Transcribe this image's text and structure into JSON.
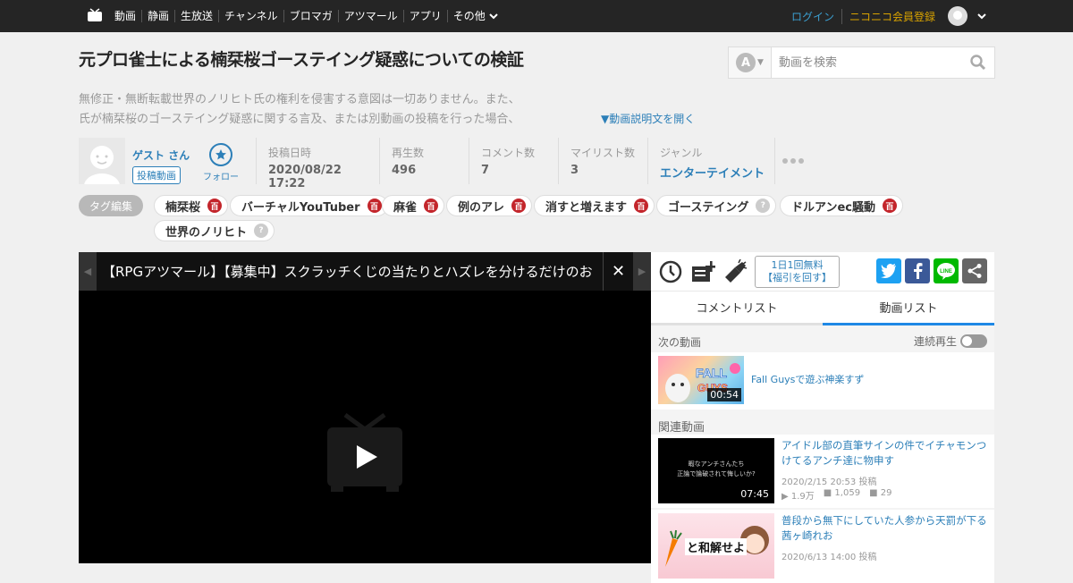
{
  "nav": {
    "items": [
      "動画",
      "静画",
      "生放送",
      "チャンネル",
      "ブロマガ",
      "アツマール",
      "アプリ"
    ],
    "more": "その他",
    "login": "ログイン",
    "register": "ニコニコ会員登録"
  },
  "video": {
    "title": "元プロ雀士による楠栞桜ゴーステイング疑惑についての検証",
    "description_line1": "無修正・無断転載世界のノリヒト氏の権利を侵害する意図は一切ありません。また、",
    "description_line2": "氏が楠栞桜のゴーステイング疑惑に関する言及、または別動画の投稿を行った場合、",
    "description_open": "▼動画説明文を開く"
  },
  "search": {
    "mode_label": "A",
    "placeholder": "動画を検索"
  },
  "uploader": {
    "name": "ゲスト さん",
    "videos_label": "投稿動画",
    "follow_label": "フォロー"
  },
  "meta": {
    "posted_label": "投稿日時",
    "posted_value": "2020/08/22 17:22",
    "views_label": "再生数",
    "views_value": "496",
    "comments_label": "コメント数",
    "comments_value": "7",
    "mylist_label": "マイリスト数",
    "mylist_value": "3",
    "genre_label": "ジャンル",
    "genre_value": "エンターテイメント"
  },
  "tags": {
    "edit_label": "タグ編集",
    "items": [
      {
        "label": "楠栞桜",
        "badge": "百"
      },
      {
        "label": "バーチャルYouTuber",
        "badge": "百"
      },
      {
        "label": "麻雀",
        "badge": "百"
      },
      {
        "label": "例のアレ",
        "badge": "百"
      },
      {
        "label": "消すと増えます",
        "badge": "百"
      },
      {
        "label": "ゴーステイング",
        "badge": "?"
      },
      {
        "label": "ドルアンec騒動",
        "badge": "百"
      },
      {
        "label": "世界のノリヒト",
        "badge": "?"
      }
    ]
  },
  "player": {
    "ad_text": "【RPGアツマール】【募集中】スクラッチくじの当たりとハズレを分けるだけのお",
    "close_label": "✕"
  },
  "side": {
    "free_line1": "1日1回無料",
    "free_line2": "【福引を回す】",
    "tabs": [
      "コメントリスト",
      "動画リスト"
    ],
    "next_label": "次の動画",
    "autoplay_label": "連続再生",
    "next_video": {
      "title": "Fall Guysで遊ぶ神楽すず",
      "duration": "00:54"
    },
    "related_label": "関連動画",
    "related": [
      {
        "title_line1": "アイドル部の直筆サインの件でイチャモンつ",
        "title_line2": "けてるアンチ達に物申す",
        "date": "2020/2/15 20:53 投稿",
        "views": "1.9万",
        "comments": "1,059",
        "mylists": "29",
        "duration": "07:45",
        "thumb_line1": "暇なアンチさんたち",
        "thumb_line2": "正論で論破されて悔しいか?"
      },
      {
        "title_line1": "普段から無下にしていた人参から天罰が下る",
        "title_line2": "茜ヶ崎れお",
        "date": "2020/6/13 14:00 投稿",
        "thumb_text": "と和解せよ"
      }
    ]
  },
  "colors": {
    "topbar": "#252525",
    "link": "#2c7fb8",
    "accent_tab": "#1e88e5",
    "tag_badge": "#c3252b",
    "register": "#d9a300"
  }
}
